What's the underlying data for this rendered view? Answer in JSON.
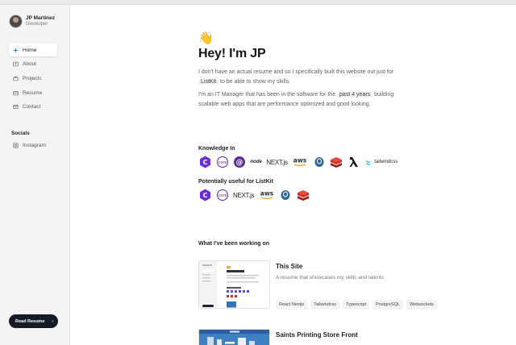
{
  "profile": {
    "name": "JP Martinez",
    "role": "Developer"
  },
  "nav": [
    {
      "label": "Home",
      "icon": "sparkle-icon",
      "active": true
    },
    {
      "label": "About",
      "icon": "id-card-icon",
      "active": false
    },
    {
      "label": "Projects",
      "icon": "briefcase-icon",
      "active": false
    },
    {
      "label": "Resume",
      "icon": "document-icon",
      "active": false
    },
    {
      "label": "Contact",
      "icon": "mail-icon",
      "active": false
    }
  ],
  "socials": {
    "heading": "Socials",
    "items": [
      {
        "label": "Instagram",
        "icon": "instagram-icon"
      }
    ]
  },
  "cta": {
    "label": "Read Resume",
    "icon": "chevron-right-icon"
  },
  "hero": {
    "emoji": "👋",
    "title": "Hey! I'm JP",
    "p1_before": "I don't have an actual resume and so I specifically built this website out just for ",
    "p1_chip": "ListKit",
    "p1_after": " to be able to show my skills.",
    "p2_before": "I'm an IT Manager that has been in the software for the ",
    "p2_chip": "past 4 years",
    "p2_after": " building scalable web apps that are performance optimized and good looking."
  },
  "knowledge": {
    "heading": "Knowledge In",
    "logos": [
      {
        "name": "csharp-logo",
        "text": "C"
      },
      {
        "name": "dotnet-core-logo",
        "text": "core"
      },
      {
        "name": "blazor-logo",
        "text": "@"
      },
      {
        "name": "nodejs-logo",
        "text": "node"
      },
      {
        "name": "nextjs-logo",
        "text": "NEXT.js"
      },
      {
        "name": "aws-logo",
        "text": "aws"
      },
      {
        "name": "postgresql-logo",
        "text": ""
      },
      {
        "name": "redis-logo",
        "text": ""
      },
      {
        "name": "aws-lambda-logo",
        "text": ""
      },
      {
        "name": "tailwindcss-logo",
        "text": "tailwindcss"
      }
    ]
  },
  "listkit": {
    "heading": "Potentially useful for ListKit",
    "logos": [
      {
        "name": "csharp-logo",
        "text": "C"
      },
      {
        "name": "dotnet-core-logo",
        "text": "core"
      },
      {
        "name": "nextjs-logo",
        "text": "NEXT.js"
      },
      {
        "name": "aws-logo",
        "text": "aws"
      },
      {
        "name": "postgresql-logo",
        "text": ""
      },
      {
        "name": "redis-logo",
        "text": ""
      }
    ]
  },
  "work": {
    "heading": "What I've been working on",
    "projects": [
      {
        "title": "This Site",
        "description": "A resume that showcases my skills and talents",
        "tags": [
          "React Nextjs",
          "Tailwindcss",
          "Typescript",
          "PostgreSQL",
          "Websockets"
        ]
      },
      {
        "title": "Saints Printing Store Front",
        "description": "",
        "tags": []
      }
    ]
  },
  "colors": {
    "cta_bg": "#151b26",
    "sidebar_bg": "#f4f4f5",
    "csharp": "#6a2ed8",
    "redis": "#c6302b",
    "postgres": "#336791",
    "tailwind": "#38bdf8",
    "aws": "#ff9900"
  }
}
